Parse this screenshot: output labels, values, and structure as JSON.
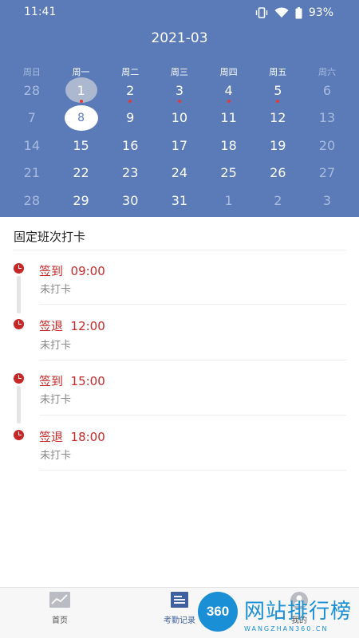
{
  "status_bar": {
    "time": "11:41",
    "battery": "93%",
    "icons": [
      "vibrate-icon",
      "wifi-icon",
      "battery-icon"
    ]
  },
  "calendar": {
    "month_title": "2021-03",
    "weekdays": [
      "周日",
      "周一",
      "周二",
      "周三",
      "周四",
      "周五",
      "周六"
    ],
    "weeks": [
      [
        "28",
        "1",
        "2",
        "3",
        "4",
        "5",
        "6"
      ],
      [
        "7",
        "8",
        "9",
        "10",
        "11",
        "12",
        "13"
      ],
      [
        "14",
        "15",
        "16",
        "17",
        "18",
        "19",
        "20"
      ],
      [
        "21",
        "22",
        "23",
        "24",
        "25",
        "26",
        "27"
      ],
      [
        "28",
        "29",
        "30",
        "31",
        "1",
        "2",
        "3"
      ]
    ],
    "selected": "8",
    "highlighted": "1",
    "marked_days": [
      "1",
      "2",
      "3",
      "4",
      "5"
    ]
  },
  "section_title": "固定班次打卡",
  "records": [
    {
      "title": "签到  09:00",
      "status": "未打卡"
    },
    {
      "title": "签退  12:00",
      "status": "未打卡"
    },
    {
      "title": "签到  15:00",
      "status": "未打卡"
    },
    {
      "title": "签退  18:00",
      "status": "未打卡"
    }
  ],
  "tabs": [
    {
      "label": "首页",
      "icon": "chart-icon"
    },
    {
      "label": "考勤记录",
      "icon": "list-icon"
    },
    {
      "label": "我的",
      "icon": "user-icon"
    }
  ],
  "watermark": {
    "badge": "360",
    "text": "网站排行榜",
    "sub": "WANGZHAN360.CN"
  },
  "colors": {
    "header_bg": "#5a7ab8",
    "accent_red": "#c62828",
    "dot_red": "#e53935",
    "tab_active": "#3f5f9e"
  }
}
